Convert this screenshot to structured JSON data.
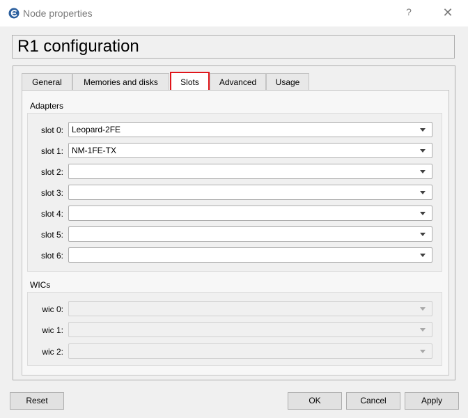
{
  "window": {
    "title": "Node properties",
    "help_label": "?",
    "close_label": "✕"
  },
  "config_title": "R1 configuration",
  "tabs": [
    "General",
    "Memories and disks",
    "Slots",
    "Advanced",
    "Usage"
  ],
  "active_tab": "Slots",
  "adapters": {
    "label": "Adapters",
    "slots": [
      {
        "label": "slot 0:",
        "value": "Leopard-2FE"
      },
      {
        "label": "slot 1:",
        "value": "NM-1FE-TX"
      },
      {
        "label": "slot 2:",
        "value": ""
      },
      {
        "label": "slot 3:",
        "value": ""
      },
      {
        "label": "slot 4:",
        "value": ""
      },
      {
        "label": "slot 5:",
        "value": ""
      },
      {
        "label": "slot 6:",
        "value": ""
      }
    ]
  },
  "wics": {
    "label": "WICs",
    "items": [
      {
        "label": "wic 0:",
        "value": ""
      },
      {
        "label": "wic 1:",
        "value": ""
      },
      {
        "label": "wic 2:",
        "value": ""
      }
    ]
  },
  "buttons": {
    "reset": "Reset",
    "ok": "OK",
    "cancel": "Cancel",
    "apply": "Apply"
  },
  "colors": {
    "active_tab_highlight": "#e0161b"
  }
}
